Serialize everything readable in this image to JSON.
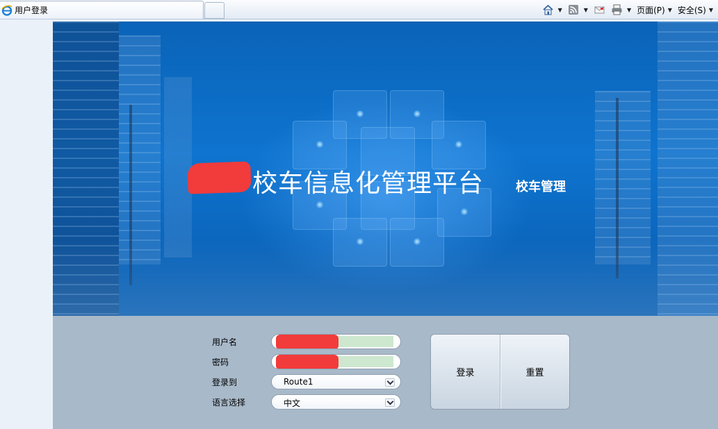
{
  "browser": {
    "tab_title": "用户登录",
    "tools": {
      "home_icon": "home-icon",
      "feeds_icon": "rss-icon",
      "mail_icon": "mail-icon",
      "print_icon": "printer-icon",
      "page_menu": "页面(P)",
      "safety_menu": "安全(S)"
    }
  },
  "banner": {
    "title": "校车信息化管理平台",
    "subtitle": "校车管理"
  },
  "login": {
    "username_label": "用户名",
    "password_label": "密码",
    "route_label": "登录到",
    "route_value": "Route1",
    "language_label": "语言选择",
    "language_value": "中文",
    "login_button": "登录",
    "reset_button": "重置"
  },
  "colors": {
    "banner_blue": "#0e74cf",
    "panel_gray": "#a8b9c9",
    "redaction": "#f23b3b",
    "input_fill": "#cde8cf"
  }
}
